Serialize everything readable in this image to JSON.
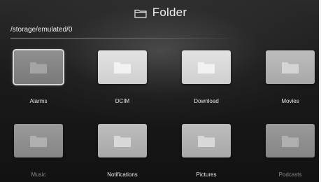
{
  "header": {
    "title": "Folder",
    "icon": "folder-outline-icon"
  },
  "path": "/storage/emulated/0",
  "folders": [
    {
      "label": "Alarms",
      "icon": "folder-icon",
      "selected": true
    },
    {
      "label": "DCIM",
      "icon": "folder-icon",
      "selected": false
    },
    {
      "label": "Download",
      "icon": "folder-icon",
      "selected": false
    },
    {
      "label": "Movies",
      "icon": "folder-icon",
      "selected": false
    },
    {
      "label": "Music",
      "icon": "folder-icon",
      "selected": false
    },
    {
      "label": "Notifications",
      "icon": "folder-icon",
      "selected": false
    },
    {
      "label": "Pictures",
      "icon": "folder-icon",
      "selected": false
    },
    {
      "label": "Podcasts",
      "icon": "folder-icon",
      "selected": false
    }
  ],
  "colors": {
    "background": "#1b1b1b",
    "text": "#e6e6e6",
    "faded_text": "#8a8a8a",
    "selection_outline": "#d8d8d8"
  }
}
